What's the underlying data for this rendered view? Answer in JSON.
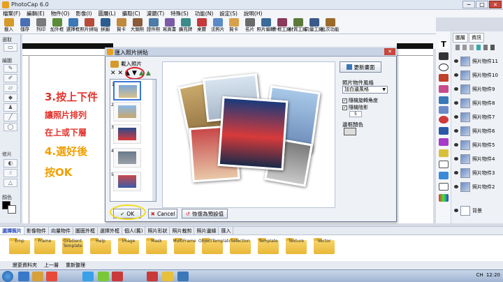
{
  "app": {
    "title": "PhotoCap 6.0",
    "window_buttons": [
      "−",
      "□",
      "×"
    ]
  },
  "menu": [
    "檔案(F)",
    "編輯(E)",
    "物件(O)",
    "影像(I)",
    "圖層(L)",
    "攝取(C)",
    "濾鏡(T)",
    "特殊(S)",
    "功能(N)",
    "設定(S)",
    "說明(H)"
  ],
  "toolbar": [
    "載入",
    "儲存",
    "列印",
    "加外框",
    "選擇框",
    "照片拼貼",
    "拼圖",
    "賀卡",
    "大頭照",
    "證件照",
    "寫真書",
    "擴充牌",
    "桌曆",
    "法照片",
    "賀卡",
    "名片",
    "照片編輯",
    "外框工廠",
    "材質工廠",
    "向量工廠",
    "批次功能"
  ],
  "left_panel": {
    "sections": [
      "選取",
      "繪圖",
      "修片",
      "顏色"
    ]
  },
  "instructions": [
    "3.按上下件",
    "讓照片排列",
    "在上或下層",
    "4.選好後",
    "按OK"
  ],
  "dialog": {
    "title": "匯入照片拼貼",
    "load_label": "載入照片",
    "tools": [
      "✕",
      "✕",
      "▲",
      "▼",
      "▲",
      "▲"
    ],
    "thumbnails": [
      "1",
      "2",
      "3",
      "4",
      "5"
    ],
    "refresh_button": "更新畫面",
    "style_label": "照片物件風格",
    "style_value": "加白邊風格",
    "check_rotate": "隨機旋轉角度",
    "check_shadow": "隨機陰影",
    "shadow_value": "5",
    "bgcolor_label": "邊框顏色",
    "ok_button": "OK",
    "cancel_button": "Cancel",
    "reset_button": "恢復為預設值"
  },
  "right_panel": {
    "tabs": [
      "圖層",
      "資訊"
    ],
    "layers": [
      "照片物件11",
      "照片物件10",
      "照片物件9",
      "照片物件8",
      "照片物件7",
      "照片物件6",
      "照片物件5",
      "照片物件4",
      "照片物件3",
      "照片物件2",
      "背景"
    ]
  },
  "bottom_tabs": [
    "選擇照片",
    "影像物件",
    "向量物件",
    "圖面外框",
    "選擇外框",
    "個人(舊)",
    "照片形狀",
    "照片裁剪",
    "照片邊緣",
    "匯入"
  ],
  "folders": [
    "Emp",
    "Frame",
    "Gradient Template",
    "Help",
    "Image",
    "Mask",
    "MultiFrame",
    "ObjectTemplate",
    "Selection",
    "Template",
    "Texture",
    "Vector"
  ],
  "status": [
    "變更資料夾",
    "上一層",
    "重新整理"
  ],
  "taskbar": {
    "time": "12:20",
    "lang": "CH"
  }
}
